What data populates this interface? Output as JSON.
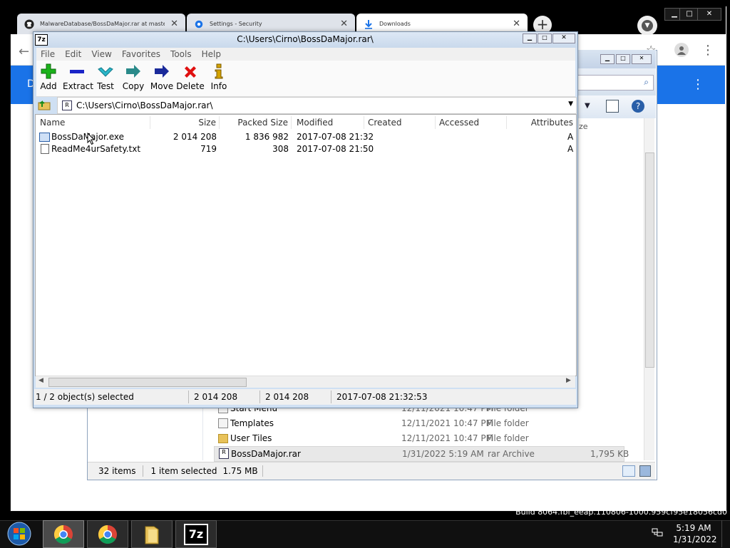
{
  "chrome": {
    "tabs": [
      {
        "title": "MalwareDatabase/BossDaMajor.rar at master · scarlettlamb…",
        "icon": "github-icon"
      },
      {
        "title": "Settings - Security",
        "icon": "gear-icon"
      },
      {
        "title": "Downloads",
        "icon": "download-icon"
      }
    ],
    "new_tab": "+"
  },
  "explorer": {
    "rows": [
      {
        "name": "Start Menu",
        "date": "12/11/2021 10:47 PM",
        "type": "File folder",
        "size": ""
      },
      {
        "name": "Templates",
        "date": "12/11/2021 10:47 PM",
        "type": "File folder",
        "size": ""
      },
      {
        "name": "User Tiles",
        "date": "12/11/2021 10:47 PM",
        "type": "File folder",
        "size": ""
      },
      {
        "name": "BossDaMajor.rar",
        "date": "1/31/2022 5:19 AM",
        "type": "rar Archive",
        "size": "1,795 KB"
      }
    ],
    "size_col_partial": "ze",
    "status": {
      "items": "32 items",
      "selected": "1 item selected",
      "size": "1.75 MB"
    }
  },
  "zip": {
    "title": "C:\\Users\\Cirno\\BossDaMajor.rar\\",
    "logo": "7z",
    "menu": [
      "File",
      "Edit",
      "View",
      "Favorites",
      "Tools",
      "Help"
    ],
    "tools": [
      {
        "label": "Add",
        "color": "#1bb21b"
      },
      {
        "label": "Extract",
        "color": "#1a24c8"
      },
      {
        "label": "Test",
        "color": "#2bb6c9"
      },
      {
        "label": "Copy",
        "color": "#2a8a8a"
      },
      {
        "label": "Move",
        "color": "#1a2a9a"
      },
      {
        "label": "Delete",
        "color": "#e01010"
      },
      {
        "label": "Info",
        "color": "#d4a300"
      }
    ],
    "address": "C:\\Users\\Cirno\\BossDaMajor.rar\\",
    "columns": [
      "Name",
      "Size",
      "Packed Size",
      "Modified",
      "Created",
      "Accessed",
      "Attributes"
    ],
    "files": [
      {
        "name": "BossDaMajor.exe",
        "size": "2 014 208",
        "packed": "1 836 982",
        "modified": "2017-07-08 21:32",
        "created": "",
        "accessed": "",
        "attr": "A"
      },
      {
        "name": "ReadMe4urSafety.txt",
        "size": "719",
        "packed": "308",
        "modified": "2017-07-08 21:50",
        "created": "",
        "accessed": "",
        "attr": "A"
      }
    ],
    "status": {
      "selection": "1 / 2 object(s) selected",
      "size": "2 014 208",
      "packed": "2 014 208",
      "modified": "2017-07-08 21:32:53"
    }
  },
  "taskbar": {
    "time": "5:19 AM",
    "date": "1/31/2022",
    "build": "Build 8064.fbl_eeap.110806-1000.959cf95e18056cd0",
    "folder_label": "",
    "zip_label": "7z"
  }
}
